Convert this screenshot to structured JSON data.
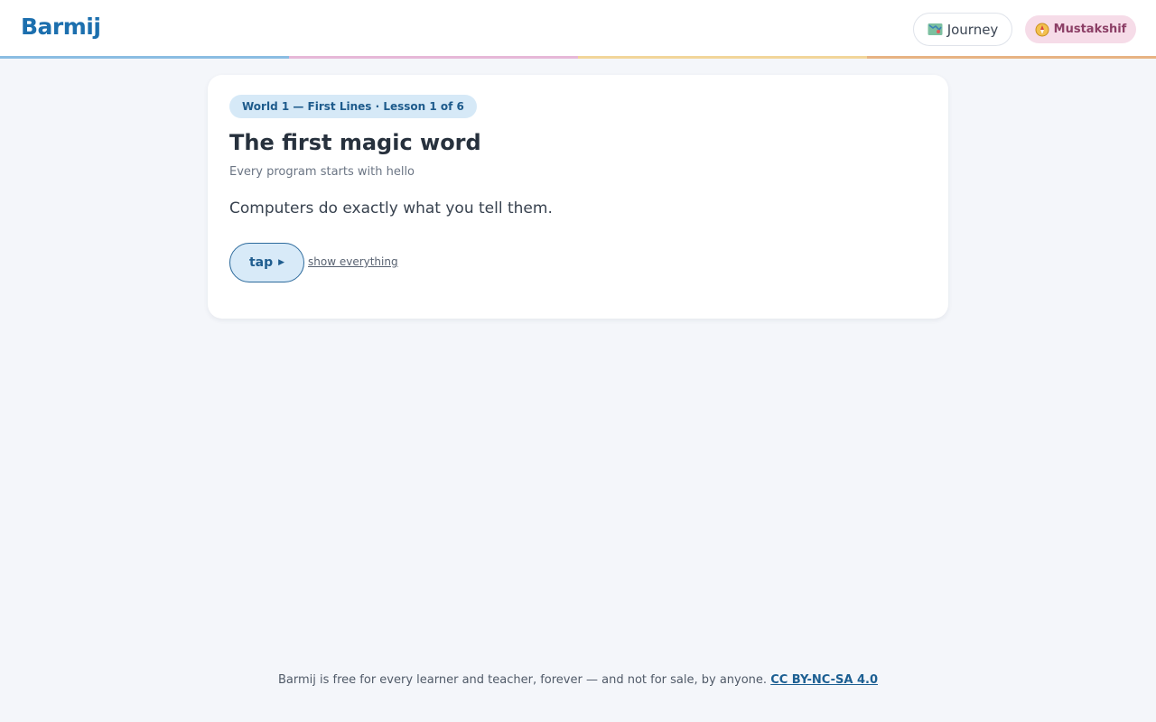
{
  "header": {
    "logo": "Barmij",
    "journey_label": "Journey",
    "journey_icon": "map-icon",
    "user_label": "Mustakshif",
    "user_icon": "compass-icon"
  },
  "colors": {
    "brand": "#1c6fae",
    "stripe": [
      "#8bbde2",
      "#e6b8d8",
      "#f2d69a",
      "#e7b383"
    ],
    "user_badge_bg": "#f6dce8"
  },
  "lesson": {
    "breadcrumb": "World 1 — First Lines · Lesson 1 of 6",
    "title": "The first magic word",
    "subtitle": "Every program starts with hello",
    "body": "Computers do exactly what you tell them.",
    "tap_label": "tap",
    "tap_icon": "play-triangle-icon",
    "show_all_label": "show everything"
  },
  "footer": {
    "text": "Barmij is free for every learner and teacher, forever — and not for sale, by anyone.",
    "license_link": "CC BY-NC-SA 4.0"
  }
}
